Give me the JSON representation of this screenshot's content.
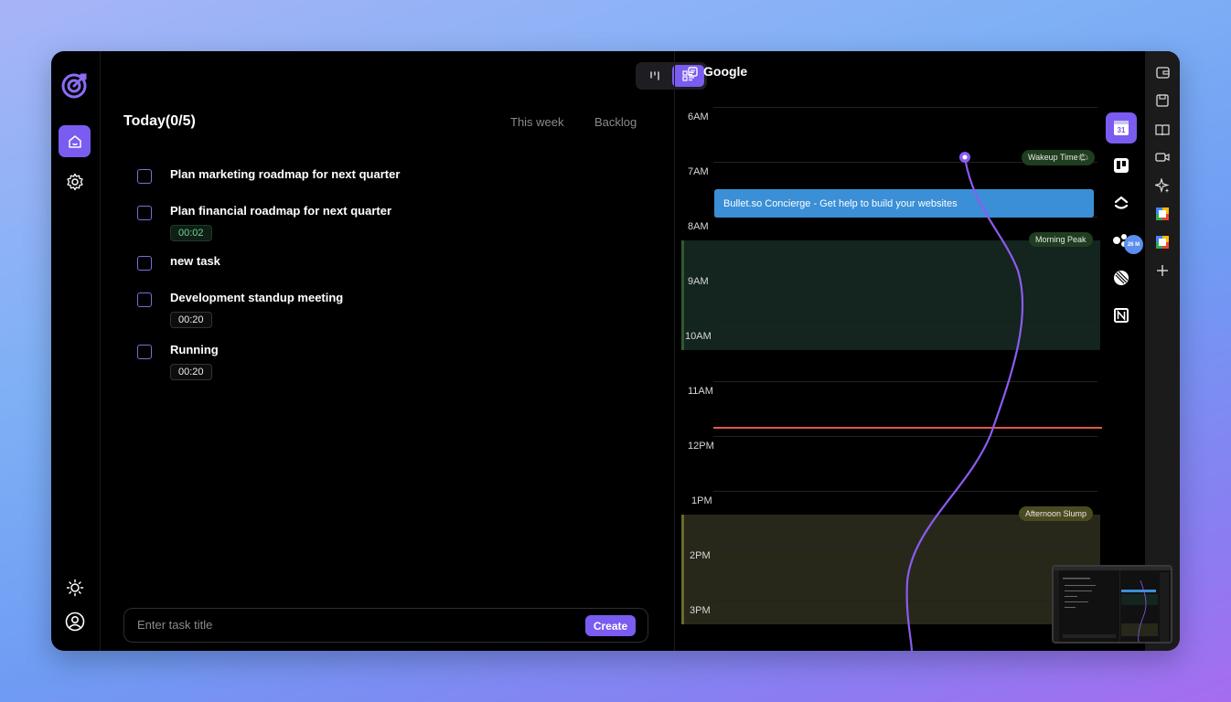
{
  "sidebar": {
    "logo": "target-logo-icon",
    "items": [
      {
        "icon": "home-icon",
        "active": true
      },
      {
        "icon": "gear-icon",
        "active": false
      }
    ],
    "bottom": [
      {
        "icon": "sun-icon"
      },
      {
        "icon": "user-circle-icon"
      }
    ]
  },
  "view_toggle": {
    "options": [
      "kanban-view-icon",
      "list-view-icon"
    ],
    "selected": "list-view-icon"
  },
  "tasks_panel": {
    "title": "Today(0/5)",
    "tabs": [
      "This week",
      "Backlog"
    ],
    "tasks": [
      {
        "label": "Plan marketing roadmap for next quarter",
        "timer": null
      },
      {
        "label": "Plan financial roadmap for next quarter",
        "timer": "00:02"
      },
      {
        "label": "new task",
        "timer": null
      },
      {
        "label": "Development standup meeting",
        "timer": "00:20"
      },
      {
        "label": "Running",
        "timer": "00:20"
      }
    ],
    "input_placeholder": "Enter task title",
    "create_label": "Create"
  },
  "calendar": {
    "title": "Google",
    "hours": [
      "6AM",
      "7AM",
      "8AM",
      "9AM",
      "10AM",
      "11AM",
      "12PM",
      "1PM",
      "2PM",
      "3PM"
    ],
    "event": "Bullet.so Concierge - Get help to build your websites",
    "energy_labels": {
      "wakeup": "Wakeup Time🌤",
      "morning": "Morning Peak",
      "afternoon": "Afternoon Slump"
    }
  },
  "integrations": {
    "items": [
      "google-calendar-icon",
      "trello-icon",
      "clickup-icon",
      "team-icon",
      "linear-icon",
      "notion-icon"
    ],
    "badge": "26 M"
  },
  "mac_bar": [
    "wallet-icon",
    "save-icon",
    "book-icon",
    "video-icon",
    "sparkle-icon",
    "calendar-app-icon",
    "calendar-app-icon-2",
    "plus-icon"
  ],
  "colors": {
    "accent": "#7a5cf0",
    "event_blue": "#3b8fd6",
    "now_line": "#e05a4a"
  }
}
